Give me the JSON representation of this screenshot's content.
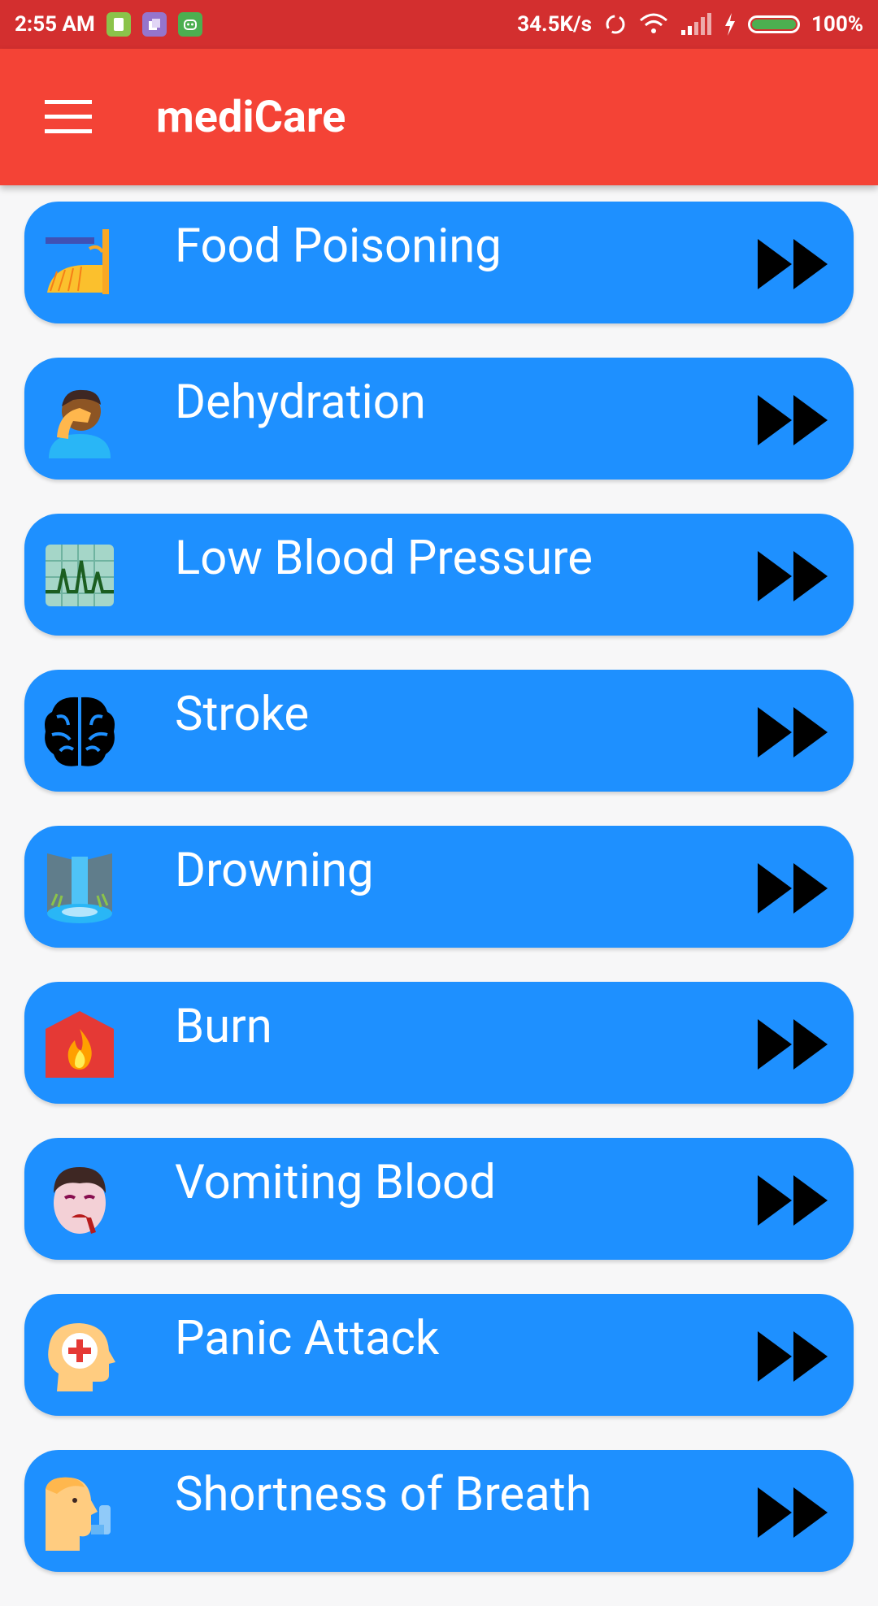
{
  "status_bar": {
    "time": "2:55 AM",
    "network_speed": "34.5K/s",
    "battery_percent": "100%"
  },
  "app_bar": {
    "title": "mediCare",
    "menu_icon": "hamburger-menu-icon"
  },
  "conditions": [
    {
      "label": "Food Poisoning",
      "icon": "toilet-icon"
    },
    {
      "label": "Dehydration",
      "icon": "facepalm-person-icon"
    },
    {
      "label": "Low Blood Pressure",
      "icon": "heart-monitor-icon"
    },
    {
      "label": "Stroke",
      "icon": "brain-icon"
    },
    {
      "label": "Drowning",
      "icon": "waterfall-icon"
    },
    {
      "label": "Burn",
      "icon": "fire-house-icon"
    },
    {
      "label": "Vomiting Blood",
      "icon": "vampire-face-icon"
    },
    {
      "label": "Panic Attack",
      "icon": "head-medical-cross-icon"
    },
    {
      "label": "Shortness of Breath",
      "icon": "head-inhaler-icon"
    }
  ],
  "colors": {
    "status_bar": "#d32f2f",
    "app_bar": "#f44336",
    "list_item": "#1e90ff"
  }
}
